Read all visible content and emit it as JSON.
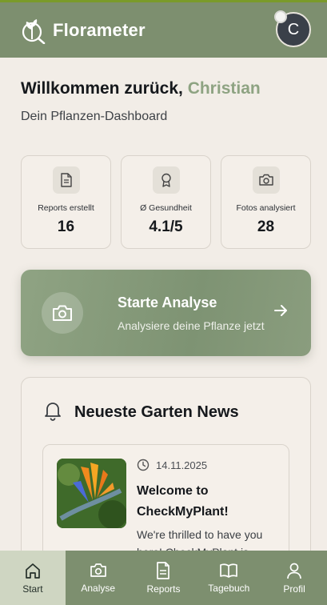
{
  "app": {
    "title": "Florameter",
    "avatar_initial": "C"
  },
  "welcome": {
    "greeting": "Willkommen zurück, ",
    "user_name": "Christian",
    "subtitle": "Dein Pflanzen-Dashboard"
  },
  "stats": [
    {
      "icon": "document-icon",
      "label": "Reports erstellt",
      "value": "16"
    },
    {
      "icon": "award-icon",
      "label": "Ø Gesundheit",
      "value": "4.1/5"
    },
    {
      "icon": "camera-icon",
      "label": "Fotos analysiert",
      "value": "28"
    }
  ],
  "cta": {
    "title": "Starte Analyse",
    "subtitle": "Analysiere deine Pflanze jetzt"
  },
  "news": {
    "title": "Neueste Garten News",
    "items": [
      {
        "date": "14.11.2025",
        "headline": "Welcome to CheckMyPlant!",
        "body": "We're thrilled to have you here! CheckMyPlant is"
      }
    ]
  },
  "nav": [
    {
      "label": "Start",
      "icon": "home-icon",
      "active": true
    },
    {
      "label": "Analyse",
      "icon": "camera-icon",
      "active": false
    },
    {
      "label": "Reports",
      "icon": "document-icon",
      "active": false
    },
    {
      "label": "Tagebuch",
      "icon": "book-icon",
      "active": false
    },
    {
      "label": "Profil",
      "icon": "user-icon",
      "active": false
    }
  ],
  "colors": {
    "header": "#7d8f6f",
    "accent": "#8ea382",
    "background": "#f2ede7",
    "nav_active": "#cfd6c2"
  }
}
